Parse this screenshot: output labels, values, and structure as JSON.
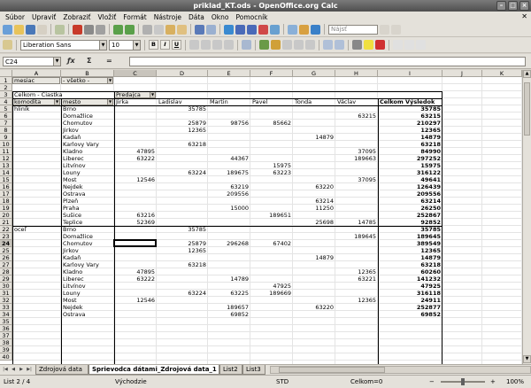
{
  "window": {
    "title": "priklad_KT.ods - OpenOffice.org Calc"
  },
  "menu": [
    "Súbor",
    "Upraviť",
    "Zobraziť",
    "Vložiť",
    "Formát",
    "Nástroje",
    "Dáta",
    "Okno",
    "Pomocník"
  ],
  "toolbar": {
    "find_placeholder": "Nájsť",
    "font_name": "Liberation Sans",
    "font_size": "10"
  },
  "formula_bar": {
    "cell_ref": "C24",
    "fx": "ƒx",
    "sum": "Σ",
    "equals": "=",
    "content": ""
  },
  "columns": [
    {
      "id": "A",
      "w": 55
    },
    {
      "id": "B",
      "w": 60
    },
    {
      "id": "C",
      "w": 48
    },
    {
      "id": "D",
      "w": 58
    },
    {
      "id": "E",
      "w": 48
    },
    {
      "id": "F",
      "w": 48
    },
    {
      "id": "G",
      "w": 48
    },
    {
      "id": "H",
      "w": 48
    },
    {
      "id": "I",
      "w": 73
    },
    {
      "id": "J",
      "w": 45
    },
    {
      "id": "K",
      "w": 45
    }
  ],
  "rows": [
    "1",
    "2",
    "3",
    "4",
    "5",
    "6",
    "7",
    "8",
    "9",
    "10",
    "11",
    "12",
    "13",
    "14",
    "15",
    "16",
    "17",
    "18",
    "19",
    "20",
    "21",
    "22",
    "23",
    "24",
    "25",
    "26",
    "27",
    "28",
    "29",
    "30",
    "31",
    "32",
    "33",
    "34",
    "35",
    "36",
    "37",
    "38",
    "39",
    "40"
  ],
  "pivot": {
    "page_field": "mesiac",
    "page_value": "- všetko -",
    "data_label": "Celkom - Čiastka",
    "row_field1": "komodita",
    "row_field2": "mesto",
    "col_field": "Predajca",
    "persons": [
      "Jirka",
      "Ladislav",
      "Martin",
      "Pavel",
      "Tonda",
      "Václav"
    ],
    "total_label": "Celkom Výsledok"
  },
  "data_rows": [
    {
      "k": "hliník",
      "m": "Brno",
      "v": [
        "",
        "35785",
        "",
        "",
        "",
        ""
      ],
      "t": "35785"
    },
    {
      "k": "",
      "m": "Domažlice",
      "v": [
        "",
        "",
        "",
        "",
        "",
        "63215"
      ],
      "t": "63215"
    },
    {
      "k": "",
      "m": "Chomutov",
      "v": [
        "",
        "25879",
        "98756",
        "85662",
        "",
        ""
      ],
      "t": "210297"
    },
    {
      "k": "",
      "m": "Jirkov",
      "v": [
        "",
        "12365",
        "",
        "",
        "",
        ""
      ],
      "t": "12365"
    },
    {
      "k": "",
      "m": "Kadaň",
      "v": [
        "",
        "",
        "",
        "",
        "14879",
        ""
      ],
      "t": "14879"
    },
    {
      "k": "",
      "m": "Karlovy Vary",
      "v": [
        "",
        "63218",
        "",
        "",
        "",
        ""
      ],
      "t": "63218"
    },
    {
      "k": "",
      "m": "Kladno",
      "v": [
        "47895",
        "",
        "",
        "",
        "",
        "37095"
      ],
      "t": "84990"
    },
    {
      "k": "",
      "m": "Liberec",
      "v": [
        "63222",
        "",
        "44367",
        "",
        "",
        "189663"
      ],
      "t": "297252"
    },
    {
      "k": "",
      "m": "Litvínov",
      "v": [
        "",
        "",
        "",
        "15975",
        "",
        ""
      ],
      "t": "15975"
    },
    {
      "k": "",
      "m": "Louny",
      "v": [
        "",
        "63224",
        "189675",
        "63223",
        "",
        ""
      ],
      "t": "316122"
    },
    {
      "k": "",
      "m": "Most",
      "v": [
        "12546",
        "",
        "",
        "",
        "",
        "37095"
      ],
      "t": "49641"
    },
    {
      "k": "",
      "m": "Nejdek",
      "v": [
        "",
        "",
        "63219",
        "",
        "63220",
        ""
      ],
      "t": "126439"
    },
    {
      "k": "",
      "m": "Ostrava",
      "v": [
        "",
        "",
        "209556",
        "",
        "",
        ""
      ],
      "t": "209556"
    },
    {
      "k": "",
      "m": "Plzeň",
      "v": [
        "",
        "",
        "",
        "",
        "63214",
        ""
      ],
      "t": "63214"
    },
    {
      "k": "",
      "m": "Praha",
      "v": [
        "",
        "",
        "15000",
        "",
        "11250",
        ""
      ],
      "t": "26250"
    },
    {
      "k": "",
      "m": "Sušice",
      "v": [
        "63216",
        "",
        "",
        "189651",
        "",
        ""
      ],
      "t": "252867"
    },
    {
      "k": "",
      "m": "Teplice",
      "v": [
        "52369",
        "",
        "",
        "",
        "25698",
        "14785"
      ],
      "t": "92852"
    },
    {
      "k": "oceľ",
      "m": "Brno",
      "v": [
        "",
        "35785",
        "",
        "",
        "",
        ""
      ],
      "t": "35785"
    },
    {
      "k": "",
      "m": "Domažlice",
      "v": [
        "",
        "",
        "",
        "",
        "",
        "189645"
      ],
      "t": "189645"
    },
    {
      "k": "",
      "m": "Chomutov",
      "v": [
        "",
        "25879",
        "296268",
        "67402",
        "",
        ""
      ],
      "t": "389549"
    },
    {
      "k": "",
      "m": "Jirkov",
      "v": [
        "",
        "12365",
        "",
        "",
        "",
        ""
      ],
      "t": "12365"
    },
    {
      "k": "",
      "m": "Kadaň",
      "v": [
        "",
        "",
        "",
        "",
        "14879",
        ""
      ],
      "t": "14879"
    },
    {
      "k": "",
      "m": "Karlovy Vary",
      "v": [
        "",
        "63218",
        "",
        "",
        "",
        ""
      ],
      "t": "63218"
    },
    {
      "k": "",
      "m": "Kladno",
      "v": [
        "47895",
        "",
        "",
        "",
        "",
        "12365"
      ],
      "t": "60260"
    },
    {
      "k": "",
      "m": "Liberec",
      "v": [
        "63222",
        "",
        "14789",
        "",
        "",
        "63221"
      ],
      "t": "141232"
    },
    {
      "k": "",
      "m": "Litvínov",
      "v": [
        "",
        "",
        "",
        "47925",
        "",
        ""
      ],
      "t": "47925"
    },
    {
      "k": "",
      "m": "Louny",
      "v": [
        "",
        "63224",
        "63225",
        "189669",
        "",
        ""
      ],
      "t": "316118"
    },
    {
      "k": "",
      "m": "Most",
      "v": [
        "12546",
        "",
        "",
        "",
        "",
        "12365"
      ],
      "t": "24911"
    },
    {
      "k": "",
      "m": "Nejdek",
      "v": [
        "",
        "",
        "189657",
        "",
        "63220",
        ""
      ],
      "t": "252877"
    },
    {
      "k": "",
      "m": "Ostrava",
      "v": [
        "",
        "",
        "69852",
        "",
        "",
        ""
      ],
      "t": "69852"
    }
  ],
  "sheet_tabs": [
    {
      "label": "Zdrojová data",
      "active": false
    },
    {
      "label": "Sprievodca dátami_Zdrojová data_1",
      "active": true
    },
    {
      "label": "List2",
      "active": false
    },
    {
      "label": "List3",
      "active": false
    }
  ],
  "status": {
    "sheet": "List 2 / 4",
    "style": "Východzie",
    "mode": "STD",
    "sum": "Celkom=0",
    "zoom": "100%"
  },
  "colors": {
    "selection": "#000000",
    "header_bg": "#e4e1da",
    "title_bg": "#555555"
  },
  "selected_cell": {
    "col": "C",
    "row": 24
  }
}
